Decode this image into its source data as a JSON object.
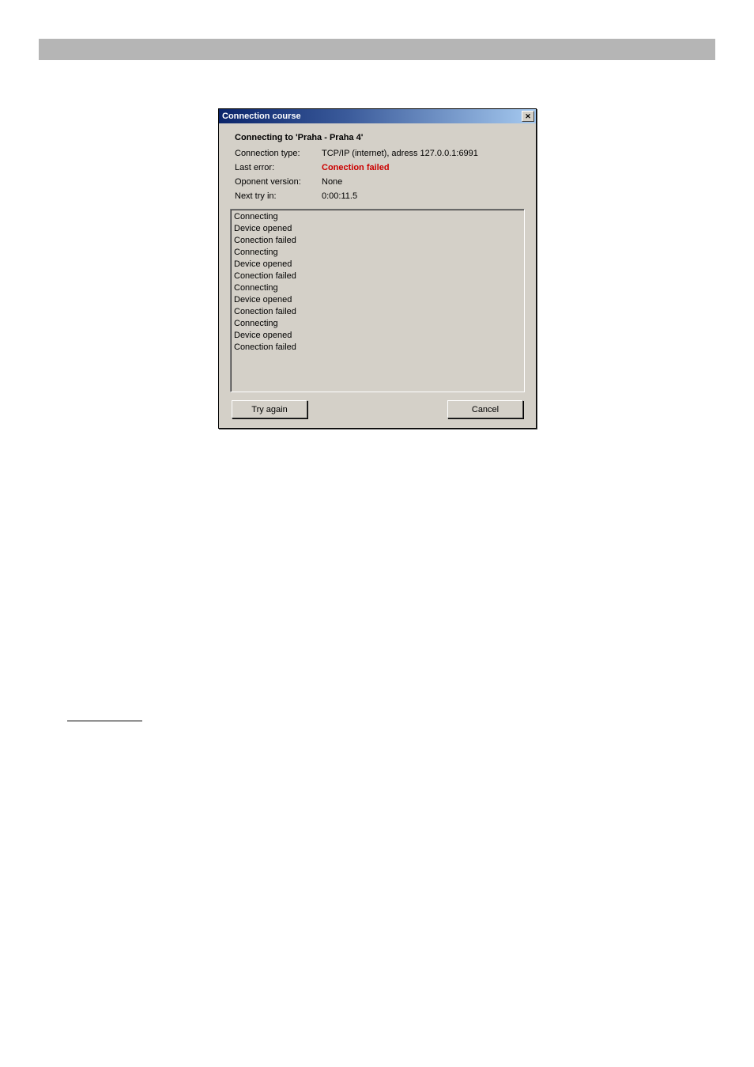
{
  "topbar": {},
  "dialog": {
    "title": "Connection course",
    "heading": "Connecting to 'Praha - Praha 4'",
    "rows": {
      "connection_type_label": "Connection type:",
      "connection_type_value": "TCP/IP (internet), adress 127.0.0.1:6991",
      "last_error_label": "Last error:",
      "last_error_value": "Conection failed",
      "oponent_version_label": "Oponent version:",
      "oponent_version_value": "None",
      "next_try_label": "Next try in:",
      "next_try_value": "0:00:11.5"
    },
    "log": [
      "Connecting",
      "Device opened",
      "Conection failed",
      "Connecting",
      "Device opened",
      "Conection failed",
      "Connecting",
      "Device opened",
      "Conection failed",
      "Connecting",
      "Device opened",
      "Conection failed"
    ],
    "buttons": {
      "try_again": "Try again",
      "cancel": "Cancel"
    }
  }
}
